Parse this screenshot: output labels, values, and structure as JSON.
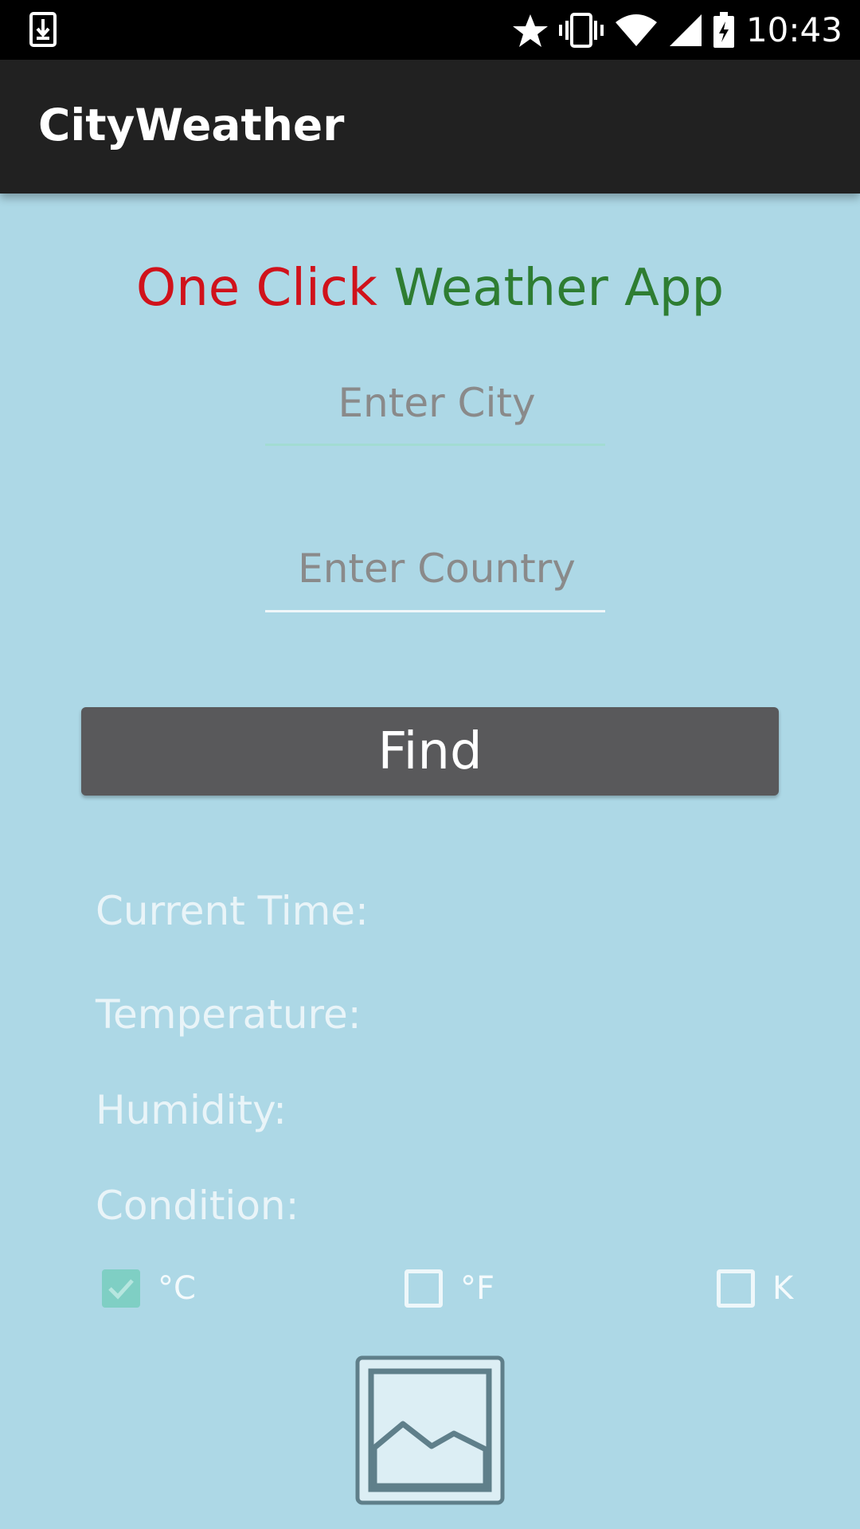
{
  "status_bar": {
    "time": "10:43",
    "icons": [
      "download-icon",
      "star-icon",
      "vibrate-icon",
      "wifi-icon",
      "signal-icon",
      "battery-icon"
    ]
  },
  "app_bar": {
    "title": "CityWeather"
  },
  "headline": {
    "part1": "One Click ",
    "part2": "Weather App",
    "color1": "#d0121b",
    "color2": "#2e7d32"
  },
  "form": {
    "city_placeholder": "Enter City",
    "city_value": "",
    "country_placeholder": "Enter Country",
    "country_value": "",
    "find_label": "Find"
  },
  "info": {
    "current_time_label": "Current Time:",
    "temperature_label": "Temperature:",
    "humidity_label": "Humidity:",
    "condition_label": "Condition:"
  },
  "units": {
    "celsius": {
      "label": "°C",
      "checked": true
    },
    "fahrenheit": {
      "label": "°F",
      "checked": false
    },
    "kelvin": {
      "label": "K",
      "checked": false
    }
  },
  "weather_image": {
    "icon": "image-placeholder-icon"
  },
  "colors": {
    "background": "#add8e6",
    "app_bar": "#212121",
    "button": "#59595b",
    "accent": "#7fcfc4"
  }
}
